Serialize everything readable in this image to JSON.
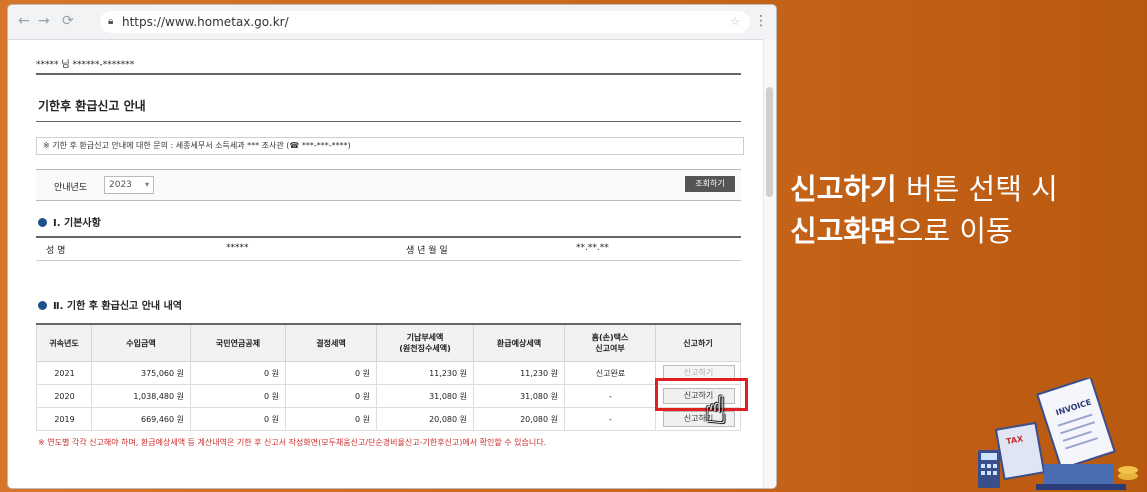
{
  "browser": {
    "url": "https://www.hometax.go.kr/"
  },
  "page": {
    "user_line": "***** 님   ******-*******",
    "title": "기한후 환급신고 안내",
    "inquiry": "※ 기한 후 환급신고 안내에 대한 문의 : 세종세무서 소득세과   ***  조사관 (☎ ***-***-****)",
    "year_label": "안내년도",
    "year_value": "2023",
    "search_button": "조회하기",
    "section1": "Ⅰ. 기본사항",
    "basic": {
      "name_label": "성        명",
      "name_value": "*****",
      "birth_label": "생  년  월  일",
      "birth_value": "**.**.**"
    },
    "section2": "Ⅱ. 기한 후 환급신고 안내 내역",
    "table": {
      "headers": [
        "귀속년도",
        "수입금액",
        "국민연금공제",
        "결정세액",
        "기납부세액\n(원천징수세액)",
        "환급예상세액",
        "홈(손)택스\n신고여부",
        "신고하기"
      ],
      "rows": [
        {
          "year": "2021",
          "income": "375,060 원",
          "pension": "0 원",
          "tax": "0 원",
          "paid": "11,230 원",
          "refund": "11,230 원",
          "status": "신고완료",
          "action": "신고하기"
        },
        {
          "year": "2020",
          "income": "1,038,480 원",
          "pension": "0 원",
          "tax": "0 원",
          "paid": "31,080 원",
          "refund": "31,080 원",
          "status": "-",
          "action": "신고하기"
        },
        {
          "year": "2019",
          "income": "669,460 원",
          "pension": "0 원",
          "tax": "0 원",
          "paid": "20,080 원",
          "refund": "20,080 원",
          "status": "-",
          "action": "신고하기"
        }
      ]
    },
    "note": "※ 연도별 각각 신고해야 하며, 환급예상세액 등 계산내역은 기한 후 신고서 작성화면(모두채움신고/단순경비율신고-기한후신고)에서 확인할 수 있습니다."
  },
  "caption": {
    "line1_bold": "신고하기",
    "line1_rest": " 버튼 선택 시",
    "line2_bold": "신고화면",
    "line2_rest": "으로 이동"
  },
  "decor": {
    "invoice": "INVOICE",
    "tax": "TAX",
    "accent": "#c9661b"
  }
}
